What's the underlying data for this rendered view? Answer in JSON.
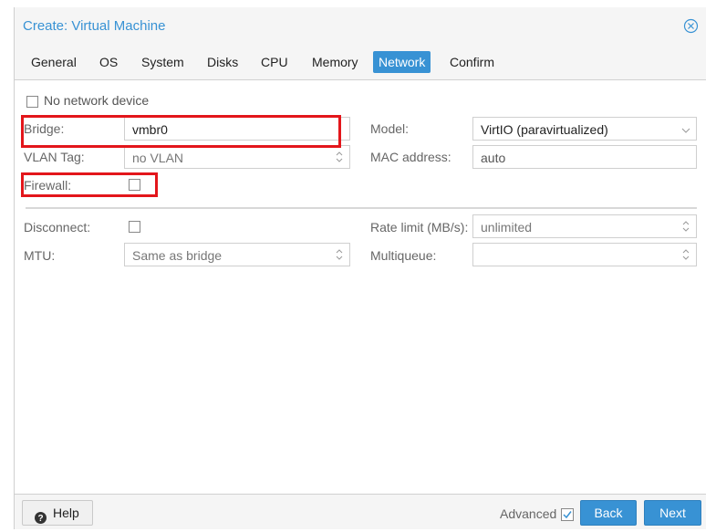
{
  "window": {
    "title": "Create: Virtual Machine"
  },
  "tabs": [
    {
      "label": "General"
    },
    {
      "label": "OS"
    },
    {
      "label": "System"
    },
    {
      "label": "Disks"
    },
    {
      "label": "CPU"
    },
    {
      "label": "Memory"
    },
    {
      "label": "Network",
      "active": true
    },
    {
      "label": "Confirm"
    }
  ],
  "form": {
    "no_network_device_label": "No network device",
    "bridge": {
      "label": "Bridge:",
      "value": "vmbr0"
    },
    "vlan_tag": {
      "label": "VLAN Tag:",
      "value": "no VLAN"
    },
    "firewall": {
      "label": "Firewall:",
      "checked": false
    },
    "model": {
      "label": "Model:",
      "value": "VirtIO (paravirtualized)"
    },
    "mac_address": {
      "label": "MAC address:",
      "value": "auto"
    },
    "disconnect": {
      "label": "Disconnect:",
      "checked": false
    },
    "mtu": {
      "label": "MTU:",
      "value": "Same as bridge"
    },
    "rate_limit": {
      "label": "Rate limit (MB/s):",
      "value": "unlimited"
    },
    "multiqueue": {
      "label": "Multiqueue:",
      "value": ""
    }
  },
  "footer": {
    "help_label": "Help",
    "advanced_label": "Advanced",
    "advanced_checked": true,
    "back_label": "Back",
    "next_label": "Next"
  },
  "colors": {
    "accent": "#3892d4",
    "highlight": "#e3161b"
  }
}
